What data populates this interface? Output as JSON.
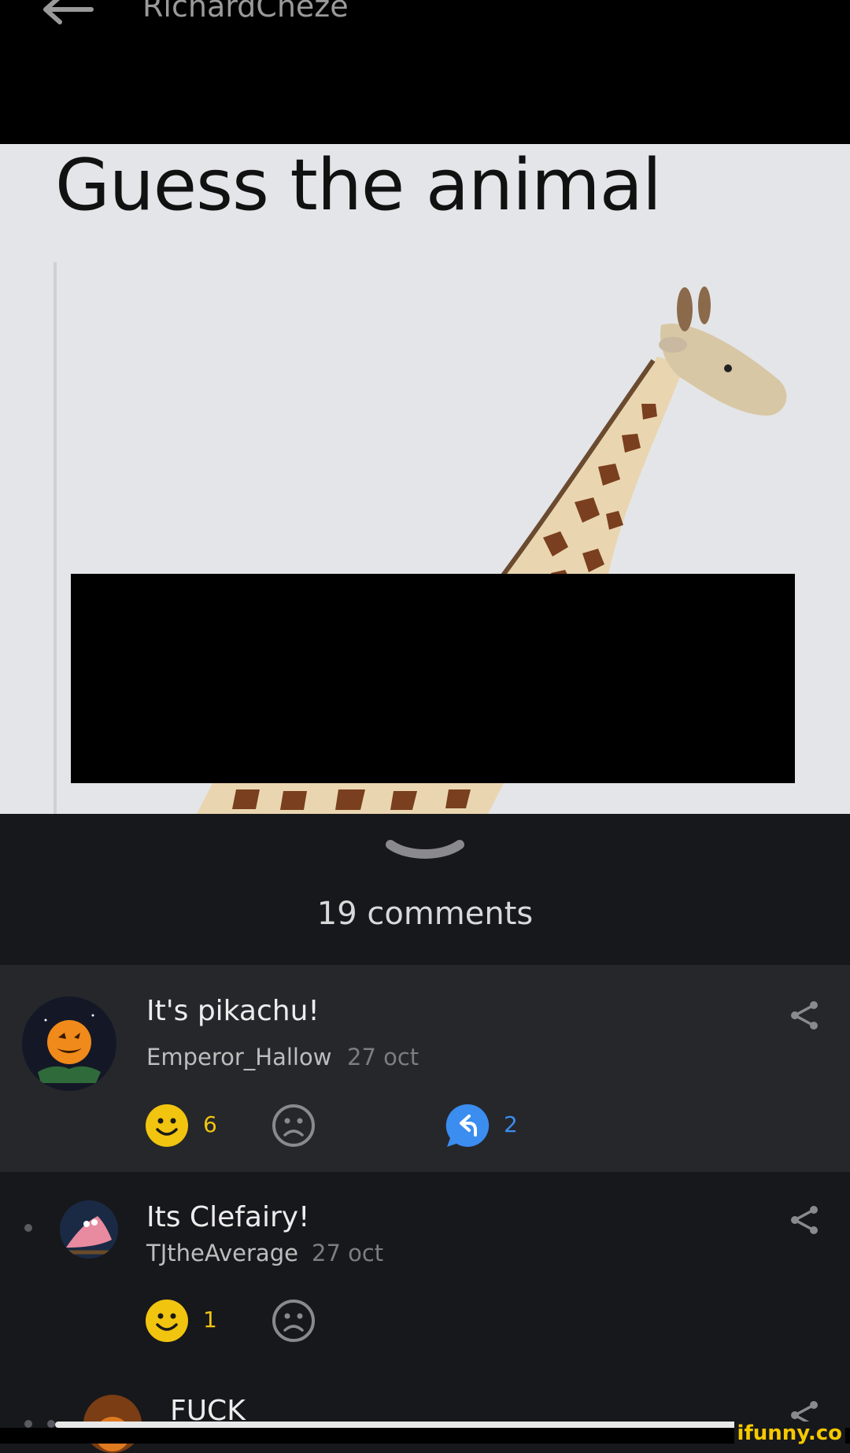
{
  "header": {
    "title": "RichardCheze"
  },
  "post": {
    "image_text": "Guess the animal"
  },
  "comments_section": {
    "count_label": "19 comments"
  },
  "comments": [
    {
      "text": "It's pikachu!",
      "user": "Emperor_Hallow",
      "date": "27 oct",
      "smiles": "6",
      "replies": "2"
    },
    {
      "text": "Its Clefairy!",
      "user": "TJtheAverage",
      "date": "27 oct",
      "smiles": "1"
    },
    {
      "text": "FUCK"
    }
  ],
  "watermark": {
    "text": "ifunny.co"
  },
  "colors": {
    "accent_yellow": "#f1c40f",
    "reply_blue": "#3b8df0",
    "background": "#17181c"
  }
}
